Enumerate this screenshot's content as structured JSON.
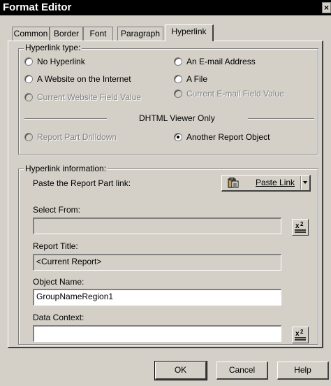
{
  "window": {
    "title": "Format Editor",
    "close_glyph": "×"
  },
  "tabs": [
    {
      "label": "Common"
    },
    {
      "label": "Border"
    },
    {
      "label": "Font"
    },
    {
      "label": "Paragraph"
    },
    {
      "label": "Hyperlink",
      "active": true
    }
  ],
  "hyperlink_type": {
    "group_label": "Hyperlink type:",
    "options": {
      "no_hyperlink": "No Hyperlink",
      "website": "A Website on the Internet",
      "current_website_field": "Current Website Field Value",
      "email": "An E-mail Address",
      "file": "A File",
      "current_email_field": "Current E-mail Field Value",
      "report_part_drilldown": "Report Part Drilldown",
      "another_report_object": "Another Report Object"
    },
    "dhtml_caption": "DHTML Viewer Only",
    "selected": "another_report_object"
  },
  "hyperlink_info": {
    "group_label": "Hyperlink information:",
    "paste_prompt": "Paste the Report Part link:",
    "paste_button": "Paste Link",
    "select_from_label": "Select From:",
    "select_from_value": "",
    "report_title_label": "Report Title:",
    "report_title_value": "<Current Report>",
    "object_name_label": "Object Name:",
    "object_name_value": "GroupNameRegion1",
    "data_context_label": "Data Context:",
    "data_context_value": ""
  },
  "footer": {
    "ok": "OK",
    "cancel": "Cancel",
    "help": "Help"
  }
}
